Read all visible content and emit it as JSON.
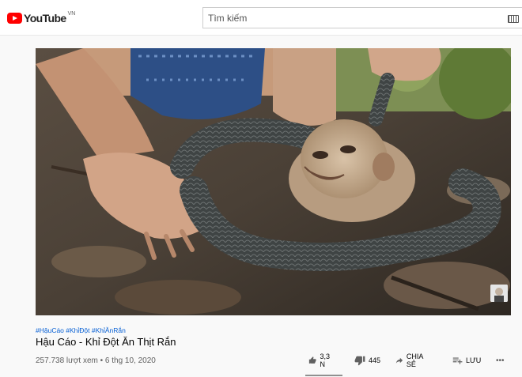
{
  "header": {
    "logo_text": "YouTube",
    "country_code": "VN",
    "search_placeholder": "Tìm kiếm"
  },
  "video": {
    "hashtags": "#HậuCáo #KhỉĐột #KhỉĂnRắn",
    "title": "Hậu Cáo - Khỉ Đột Ăn Thịt Rắn",
    "views_date": "257.738 lượt xem • 6 thg 10, 2020"
  },
  "actions": {
    "like_count": "3,3 N",
    "dislike_count": "445",
    "share_label": "CHIA SẺ",
    "save_label": "LƯU",
    "more_label": "•••"
  },
  "icons": {
    "logo": "youtube-logo-icon",
    "keyboard": "keyboard-icon",
    "like": "thumbs-up-icon",
    "dislike": "thumbs-down-icon",
    "share": "share-arrow-icon",
    "save": "playlist-add-icon",
    "more": "more-horizontal-icon"
  },
  "colors": {
    "brand_red": "#ff0000",
    "hashtag_blue": "#065fd4",
    "text_primary": "#030303",
    "text_secondary": "#606060"
  }
}
